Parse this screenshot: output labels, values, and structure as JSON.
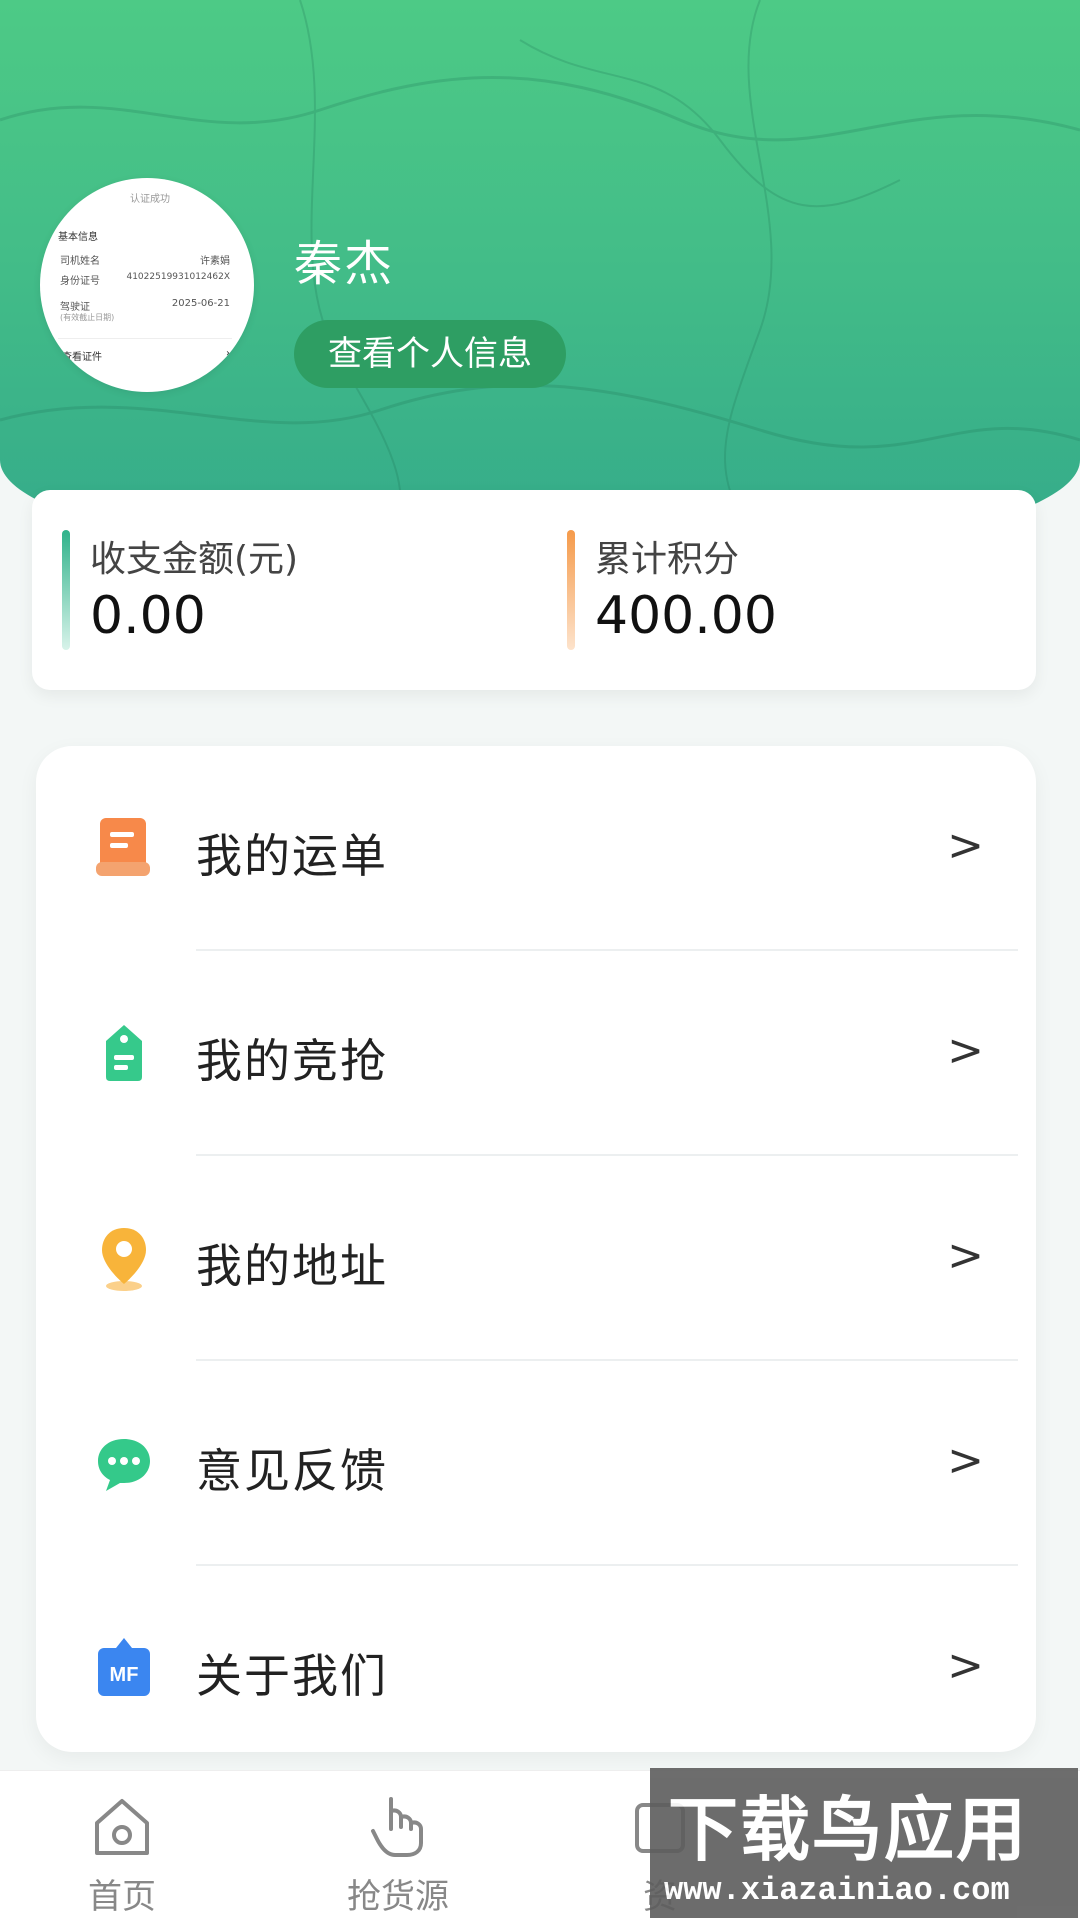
{
  "profile": {
    "name": "秦杰",
    "view_info_button": "查看个人信息",
    "avatar_doc": {
      "top_text": "认证成功",
      "section": "基本信息",
      "rows": [
        {
          "label": "司机姓名",
          "value": "许素娟"
        },
        {
          "label": "身份证号",
          "value": "41022519931012462X"
        },
        {
          "label": "驾驶证",
          "value": "2025-06-21"
        }
      ],
      "sub_note": "(有效截止日期)",
      "cert_link": "查看证件"
    }
  },
  "stats": {
    "balance_label": "收支金额(元)",
    "balance_value": "0.00",
    "points_label": "累计积分",
    "points_value": "400.00",
    "balance_color": "#2fb28a",
    "points_color": "#f59a4a"
  },
  "menu": [
    {
      "label": "我的运单",
      "icon": "waybill-icon"
    },
    {
      "label": "我的竞抢",
      "icon": "bid-tag-icon"
    },
    {
      "label": "我的地址",
      "icon": "location-pin-icon"
    },
    {
      "label": "意见反馈",
      "icon": "feedback-chat-icon"
    },
    {
      "label": "关于我们",
      "icon": "about-mf-icon"
    }
  ],
  "nav": {
    "home": "首页",
    "grab": "抢货源",
    "assets": "资"
  },
  "watermark": {
    "title": "下载鸟应用",
    "url": "www.xiazainiao.com"
  }
}
